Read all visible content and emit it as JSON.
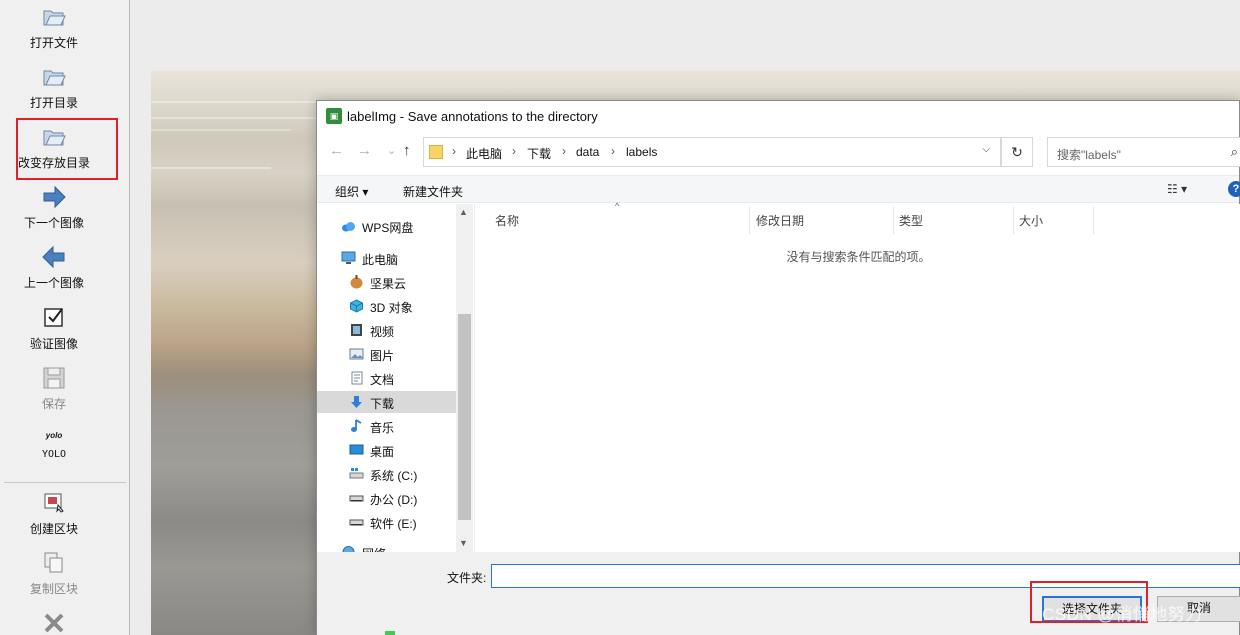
{
  "toolbar": {
    "items": [
      {
        "label": "打开文件",
        "icon": "open-file-icon"
      },
      {
        "label": "打开目录",
        "icon": "open-dir-icon"
      },
      {
        "label": "改变存放目录",
        "icon": "change-save-dir-icon"
      },
      {
        "label": "下一个图像",
        "icon": "arrow-right-icon"
      },
      {
        "label": "上一个图像",
        "icon": "arrow-left-icon"
      },
      {
        "label": "验证图像",
        "icon": "checkbox-icon"
      },
      {
        "label": "保存",
        "icon": "floppy-icon"
      },
      {
        "label": "YOLO",
        "icon_text": "yolo"
      },
      {
        "label": "创建区块",
        "icon": "create-rect-icon"
      },
      {
        "label": "复制区块",
        "icon": "copy-rect-icon"
      },
      {
        "label": "",
        "icon": "delete-rect-icon"
      }
    ]
  },
  "dialog": {
    "title": "labelImg - Save annotations to the directory",
    "address": {
      "crumbs": [
        "此电脑",
        "下载",
        "data",
        "labels"
      ]
    },
    "search_placeholder": "搜索\"labels\"",
    "commands": {
      "organize": "组织 ▾",
      "new_folder": "新建文件夹"
    },
    "nav_items": [
      {
        "label": "WPS网盘",
        "icon": "cloud-icon"
      },
      {
        "label": "此电脑",
        "icon": "computer-icon"
      },
      {
        "label": "坚果云",
        "icon": "nut-icon"
      },
      {
        "label": "3D 对象",
        "icon": "cube-icon"
      },
      {
        "label": "视频",
        "icon": "film-icon"
      },
      {
        "label": "图片",
        "icon": "picture-icon"
      },
      {
        "label": "文档",
        "icon": "document-icon"
      },
      {
        "label": "下载",
        "icon": "download-icon",
        "selected": true
      },
      {
        "label": "音乐",
        "icon": "music-icon"
      },
      {
        "label": "桌面",
        "icon": "desktop-icon"
      },
      {
        "label": "系统 (C:)",
        "icon": "drive-c-icon"
      },
      {
        "label": "办公 (D:)",
        "icon": "drive-icon"
      },
      {
        "label": "软件 (E:)",
        "icon": "drive-icon"
      },
      {
        "label": "网络",
        "icon": "network-icon"
      }
    ],
    "columns": [
      "名称",
      "修改日期",
      "类型",
      "大小"
    ],
    "empty_message": "没有与搜索条件匹配的项。",
    "folder_label": "文件夹:",
    "folder_value": "",
    "buttons": {
      "select_folder": "选择文件夹",
      "cancel": "取消"
    }
  },
  "watermark": "CSDN @悄悄地努力",
  "colors": {
    "highlight_red": "#e0202a",
    "selection_blue": "#2477d4"
  }
}
